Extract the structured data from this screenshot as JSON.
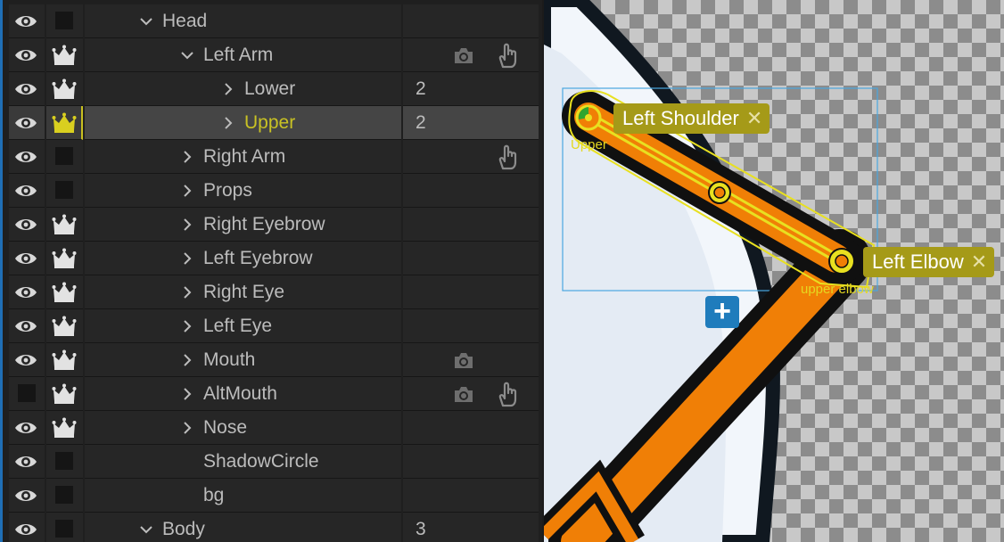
{
  "layers": [
    {
      "label": "Head",
      "indent": 0,
      "expanded": true,
      "eye": true,
      "crown": false,
      "count": "",
      "camera": false,
      "hand": false,
      "selected": false
    },
    {
      "label": "Left Arm",
      "indent": 1,
      "expanded": true,
      "eye": true,
      "crown": true,
      "count": "",
      "camera": true,
      "hand": true,
      "selected": false
    },
    {
      "label": "Lower",
      "indent": 2,
      "expanded": false,
      "eye": true,
      "crown": true,
      "count": "2",
      "camera": false,
      "hand": false,
      "selected": false
    },
    {
      "label": "Upper",
      "indent": 2,
      "expanded": false,
      "eye": true,
      "crown": true,
      "count": "2",
      "camera": false,
      "hand": false,
      "selected": true
    },
    {
      "label": "Right Arm",
      "indent": 1,
      "expanded": false,
      "eye": true,
      "crown": false,
      "count": "",
      "camera": false,
      "hand": true,
      "selected": false
    },
    {
      "label": "Props",
      "indent": 1,
      "expanded": false,
      "eye": true,
      "crown": false,
      "count": "",
      "camera": false,
      "hand": false,
      "selected": false
    },
    {
      "label": "Right Eyebrow",
      "indent": 1,
      "expanded": false,
      "eye": true,
      "crown": true,
      "count": "",
      "camera": false,
      "hand": false,
      "selected": false
    },
    {
      "label": "Left Eyebrow",
      "indent": 1,
      "expanded": false,
      "eye": true,
      "crown": true,
      "count": "",
      "camera": false,
      "hand": false,
      "selected": false
    },
    {
      "label": "Right Eye",
      "indent": 1,
      "expanded": false,
      "eye": true,
      "crown": true,
      "count": "",
      "camera": false,
      "hand": false,
      "selected": false
    },
    {
      "label": "Left Eye",
      "indent": 1,
      "expanded": false,
      "eye": true,
      "crown": true,
      "count": "",
      "camera": false,
      "hand": false,
      "selected": false
    },
    {
      "label": "Mouth",
      "indent": 1,
      "expanded": false,
      "eye": true,
      "crown": true,
      "count": "",
      "camera": true,
      "hand": false,
      "selected": false
    },
    {
      "label": "AltMouth",
      "indent": 1,
      "expanded": false,
      "eye": false,
      "crown": true,
      "count": "",
      "camera": true,
      "hand": true,
      "selected": false
    },
    {
      "label": "Nose",
      "indent": 1,
      "expanded": false,
      "eye": true,
      "crown": true,
      "count": "",
      "camera": false,
      "hand": false,
      "selected": false
    },
    {
      "label": "ShadowCircle",
      "indent": 1,
      "leaf": true,
      "eye": true,
      "crown": false,
      "count": "",
      "camera": false,
      "hand": false,
      "selected": false
    },
    {
      "label": "bg",
      "indent": 1,
      "leaf": true,
      "eye": true,
      "crown": false,
      "count": "",
      "camera": false,
      "hand": false,
      "selected": false
    },
    {
      "label": "Body",
      "indent": 0,
      "expanded": true,
      "eye": true,
      "crown": false,
      "count": "3",
      "camera": false,
      "hand": false,
      "selected": false
    }
  ],
  "viewport": {
    "handles": {
      "left_shoulder_tag": "Left Shoulder",
      "left_elbow_tag": "Left Elbow",
      "upper_label": "Upper",
      "upper_elbow_label": "upper elbow",
      "close_glyph": "✕",
      "add_glyph": "+"
    }
  },
  "colors": {
    "panel_bg": "#1f1f1f",
    "row_bg": "#262626",
    "selected_bg": "#454545",
    "selected_text": "#c9c224",
    "arm_orange": "#f07f06",
    "handle_yellow": "#e8e020",
    "tag_bg": "#a59a18",
    "add_button": "#1f7cbc"
  },
  "icons": {
    "visibility": "eye-icon",
    "rig": "crown-icon",
    "camera": "camera-icon",
    "drag": "hand-icon",
    "expand": "chevron-right-icon",
    "collapse": "chevron-down-icon"
  }
}
